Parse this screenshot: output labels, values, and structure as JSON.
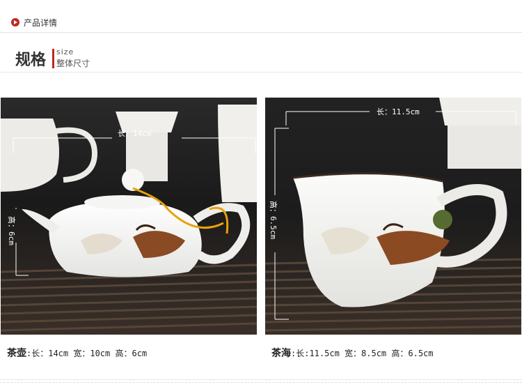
{
  "header": {
    "section_label": "产品详情",
    "title": "规格",
    "size_en": "size",
    "size_cn": "整体尺寸"
  },
  "left_photo": {
    "width_label": "长：14cm",
    "height_label": "高：6cm"
  },
  "right_photo": {
    "width_label": "长：11.5cm",
    "height_label": "高：6.5cm"
  },
  "captions": {
    "left_name": "茶壶",
    "left_dims": ":长：14cm 宽：10cm 高：6cm",
    "right_name": "茶海",
    "right_dims": ":长:11.5cm 宽：8.5cm 高：6.5cm"
  },
  "icons": [
    "play-icon"
  ],
  "colors": {
    "accent": "#c0281f"
  }
}
